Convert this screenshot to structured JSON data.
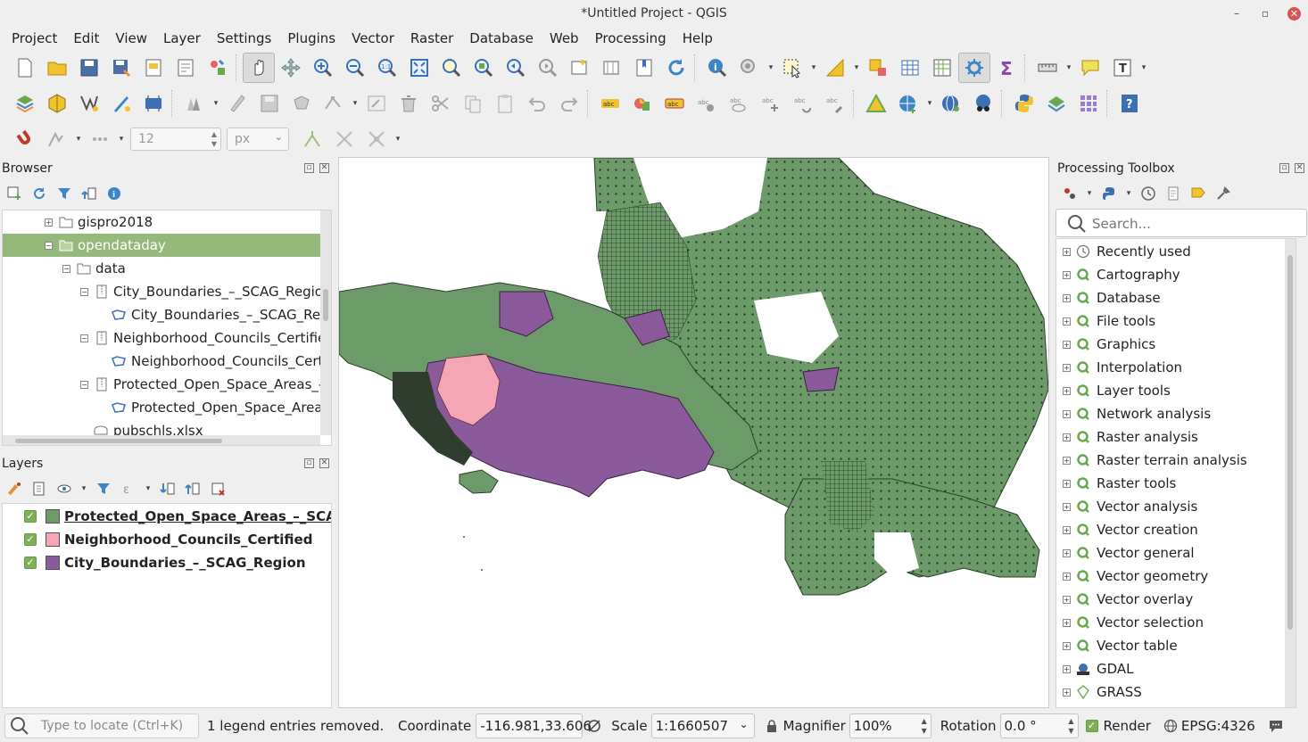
{
  "window": {
    "title": "*Untitled Project - QGIS",
    "minimize": "–",
    "restore": "▫",
    "close": "✕"
  },
  "menubar": [
    "Project",
    "Edit",
    "View",
    "Layer",
    "Settings",
    "Plugins",
    "Vector",
    "Raster",
    "Database",
    "Web",
    "Processing",
    "Help"
  ],
  "snapping": {
    "tolerance": "12",
    "unit": "px"
  },
  "browser": {
    "title": "Browser",
    "items": [
      {
        "label": "gispro2018",
        "indent": 0,
        "expander": "+",
        "icon": "folder-icon",
        "selected": false
      },
      {
        "label": "opendataday",
        "indent": 0,
        "expander": "−",
        "icon": "folder-icon",
        "selected": true
      },
      {
        "label": "data",
        "indent": 1,
        "expander": "−",
        "icon": "folder-icon",
        "selected": false
      },
      {
        "label": "City_Boundaries_–_SCAG_Region.",
        "indent": 2,
        "expander": "−",
        "icon": "zip-archive-icon",
        "selected": false
      },
      {
        "label": "City_Boundaries_–_SCAG_Regi",
        "indent": 3,
        "expander": "",
        "icon": "polygon-layer-icon",
        "selected": false
      },
      {
        "label": "Neighborhood_Councils_Certified",
        "indent": 2,
        "expander": "−",
        "icon": "zip-archive-icon",
        "selected": false
      },
      {
        "label": "Neighborhood_Councils_Certif",
        "indent": 3,
        "expander": "",
        "icon": "polygon-layer-icon",
        "selected": false
      },
      {
        "label": "Protected_Open_Space_Areas_–_S",
        "indent": 2,
        "expander": "−",
        "icon": "zip-archive-icon",
        "selected": false
      },
      {
        "label": "Protected_Open_Space_Areas_",
        "indent": 3,
        "expander": "",
        "icon": "polygon-layer-icon",
        "selected": false
      },
      {
        "label": "pubschls.xlsx",
        "indent": 1,
        "expander": "",
        "icon": "spreadsheet-icon",
        "selected": false
      }
    ]
  },
  "layers": {
    "title": "Layers",
    "items": [
      {
        "label": "Protected_Open_Space_Areas_–_SCAG_...",
        "color": "#6c9b69",
        "checked": true,
        "underline": true
      },
      {
        "label": "Neighborhood_Councils_Certified",
        "color": "#f4a6b4",
        "checked": true,
        "underline": false
      },
      {
        "label": "City_Boundaries_–_SCAG_Region",
        "color": "#8b5a9b",
        "checked": true,
        "underline": false
      }
    ]
  },
  "processing": {
    "title": "Processing Toolbox",
    "search_placeholder": "Search...",
    "items": [
      {
        "label": "Recently used",
        "icon": "clock-icon"
      },
      {
        "label": "Cartography",
        "icon": "qgis-q-icon"
      },
      {
        "label": "Database",
        "icon": "qgis-q-icon"
      },
      {
        "label": "File tools",
        "icon": "qgis-q-icon"
      },
      {
        "label": "Graphics",
        "icon": "qgis-q-icon"
      },
      {
        "label": "Interpolation",
        "icon": "qgis-q-icon"
      },
      {
        "label": "Layer tools",
        "icon": "qgis-q-icon"
      },
      {
        "label": "Network analysis",
        "icon": "qgis-q-icon"
      },
      {
        "label": "Raster analysis",
        "icon": "qgis-q-icon"
      },
      {
        "label": "Raster terrain analysis",
        "icon": "qgis-q-icon"
      },
      {
        "label": "Raster tools",
        "icon": "qgis-q-icon"
      },
      {
        "label": "Vector analysis",
        "icon": "qgis-q-icon"
      },
      {
        "label": "Vector creation",
        "icon": "qgis-q-icon"
      },
      {
        "label": "Vector general",
        "icon": "qgis-q-icon"
      },
      {
        "label": "Vector geometry",
        "icon": "qgis-q-icon"
      },
      {
        "label": "Vector overlay",
        "icon": "qgis-q-icon"
      },
      {
        "label": "Vector selection",
        "icon": "qgis-q-icon"
      },
      {
        "label": "Vector table",
        "icon": "qgis-q-icon"
      },
      {
        "label": "GDAL",
        "icon": "gdal-icon"
      },
      {
        "label": "GRASS",
        "icon": "grass-icon"
      }
    ]
  },
  "statusbar": {
    "locate_placeholder": "Type to locate (Ctrl+K)",
    "message": "1 legend entries removed.",
    "coordinate_label": "Coordinate",
    "coordinate_value": "-116.981,33.606",
    "scale_label": "Scale",
    "scale_value": "1:1660507",
    "magnifier_label": "Magnifier",
    "magnifier_value": "100%",
    "rotation_label": "Rotation",
    "rotation_value": "0.0 °",
    "render_label": "Render",
    "crs": "EPSG:4326"
  }
}
